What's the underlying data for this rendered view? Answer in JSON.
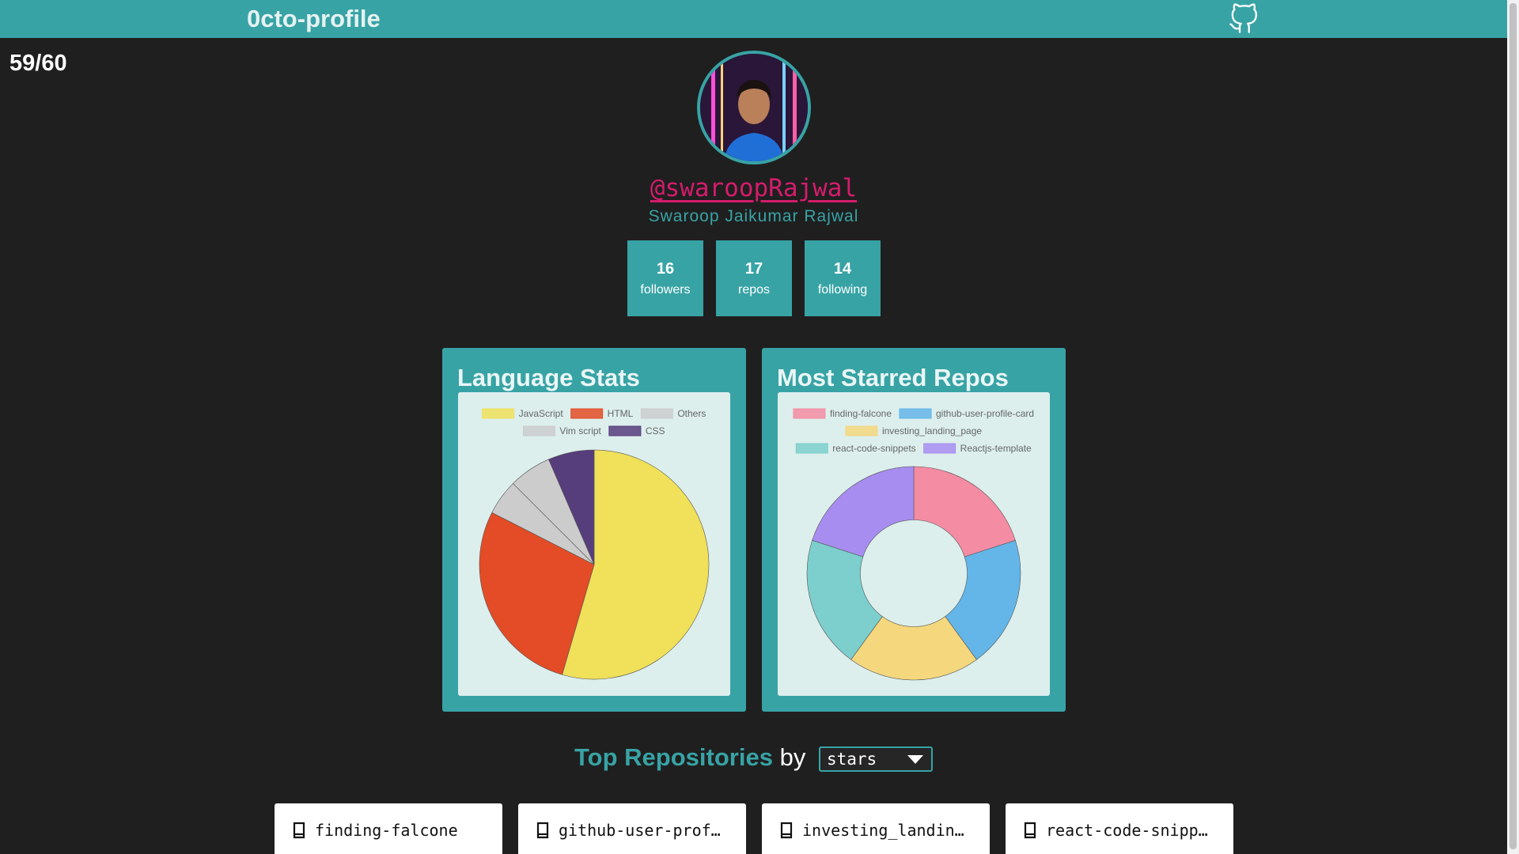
{
  "header": {
    "brand": "0cto-profile",
    "github_icon": "github-icon"
  },
  "rate_limit": "59/60",
  "profile": {
    "login": "@swaroopRajwal",
    "name": "Swaroop Jaikumar Rajwal",
    "stats": [
      {
        "value": "16",
        "label": "followers"
      },
      {
        "value": "17",
        "label": "repos"
      },
      {
        "value": "14",
        "label": "following"
      }
    ]
  },
  "language_card": {
    "title": "Language Stats"
  },
  "starred_card": {
    "title": "Most Starred Repos"
  },
  "chart_data": [
    {
      "type": "pie",
      "categories": [
        "JavaScript",
        "HTML",
        "Others",
        "Vim script",
        "CSS"
      ],
      "values": [
        54.5,
        28.0,
        5.0,
        6.0,
        6.5
      ],
      "colors": [
        "#f0e05a",
        "#e34c26",
        "#cccccc",
        "#cccccc",
        "#563d7c"
      ],
      "legend": "top"
    },
    {
      "type": "pie",
      "categories": [
        "finding-falcone",
        "github-user-profile-card",
        "investing_landing_page",
        "react-code-snippets",
        "Reactjs-template"
      ],
      "values": [
        1,
        1,
        1,
        1,
        1
      ],
      "colors": [
        "#f48ca3",
        "#64b5e8",
        "#f5d77e",
        "#7ccfcc",
        "#a88df0"
      ],
      "legend": "top"
    }
  ],
  "top_repos": {
    "title": "Top Repositories",
    "by": "by",
    "sort_value": "stars",
    "repos": [
      {
        "name": "finding-falcone"
      },
      {
        "name": "github-user-profile-card"
      },
      {
        "name": "investing_landing_page"
      },
      {
        "name": "react-code-snippets"
      }
    ]
  },
  "colors": {
    "accent": "#38a3a5",
    "login": "#d41c6c",
    "background": "#1f1f1f"
  }
}
